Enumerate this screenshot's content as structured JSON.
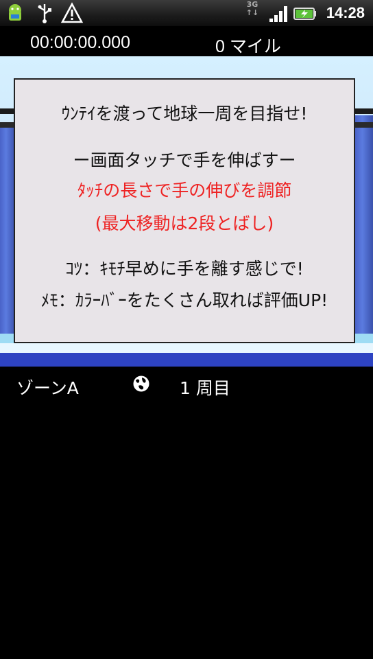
{
  "status_bar": {
    "time": "14:28",
    "network": "3G",
    "icons": [
      "android-notification-icon",
      "usb-icon",
      "warning-icon",
      "3g-icon",
      "signal-icon",
      "battery-charging-icon"
    ]
  },
  "hud": {
    "timer": "00:00:00.000",
    "distance": "0 マイル"
  },
  "dialog": {
    "line1": "ｳﾝﾃｲを渡って地球一周を目指せ!",
    "line2": "ー画面タッチで手を伸ばすー",
    "line3": "ﾀｯﾁの長さで手の伸びを調節",
    "line4": "(最大移動は2段とばし)",
    "line5": "ｺﾂ：ｷﾓﾁ早めに手を離す感じで!",
    "line6": "ﾒﾓ：ｶﾗｰﾊﾞｰをたくさん取れば評価UP!",
    "accent_color": "#ee2222"
  },
  "footer": {
    "zone": "ゾーンA",
    "lap": "1 周目",
    "globe_icon": "globe-icon"
  }
}
